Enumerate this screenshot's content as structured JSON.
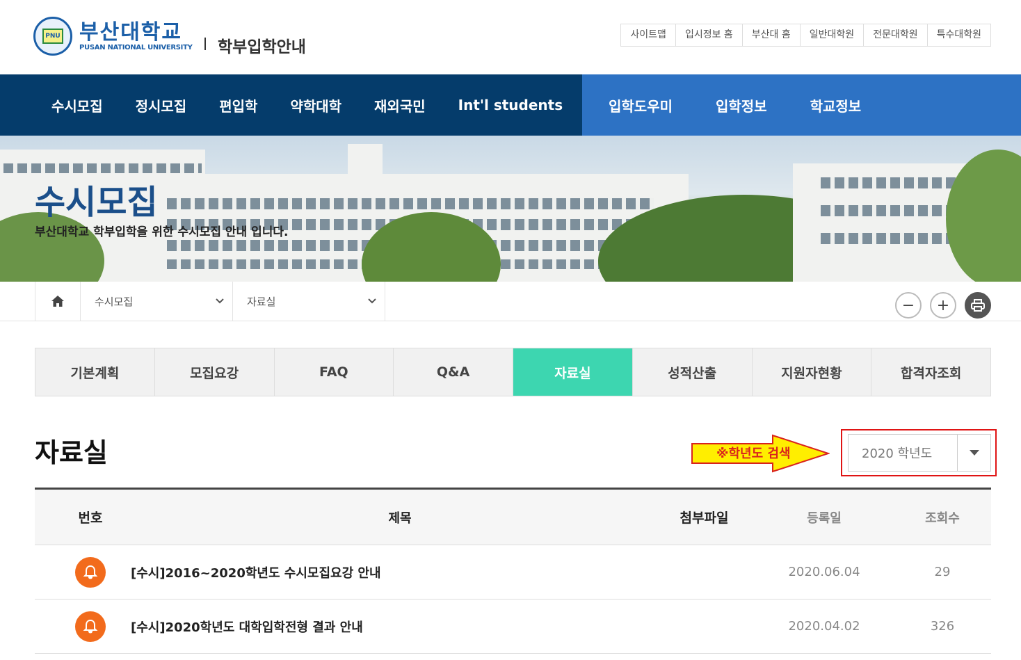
{
  "header": {
    "logo_kr": "부산대학교",
    "logo_en": "PUSAN NATIONAL UNIVERSITY",
    "logo_sub": "학부입학안내",
    "util_links": [
      "사이트맵",
      "입시정보 홈",
      "부산대 홈",
      "일반대학원",
      "전문대학원",
      "특수대학원"
    ]
  },
  "gnb": {
    "left": [
      "수시모집",
      "정시모집",
      "편입학",
      "약학대학",
      "재외국민",
      "Int'l students"
    ],
    "right": [
      "입학도우미",
      "입학정보",
      "학교정보"
    ]
  },
  "visual": {
    "title": "수시모집",
    "desc": "부산대학교 학부입학을 위한 수시모집 안내 입니다."
  },
  "location": {
    "home_icon": "home-icon",
    "sel1": "수시모집",
    "sel2": "자료실",
    "zoom_out": "−",
    "zoom_in": "+",
    "print_icon": "print-icon"
  },
  "tabs": [
    "기본계획",
    "모집요강",
    "FAQ",
    "Q&A",
    "자료실",
    "성적산출",
    "지원자현황",
    "합격자조회"
  ],
  "active_tab": 4,
  "page": {
    "title": "자료실",
    "annotation": "※학년도 검색",
    "year_select": "2020 학년도"
  },
  "table": {
    "headers": [
      "번호",
      "제목",
      "첨부파일",
      "등록일",
      "조회수"
    ],
    "rows": [
      {
        "title": "[수시]2016~2020학년도 수시모집요강 안내",
        "date": "2020.06.04",
        "views": "29"
      },
      {
        "title": "[수시]2020학년도 대학입학전형 결과 안내",
        "date": "2020.04.02",
        "views": "326"
      }
    ]
  },
  "colors": {
    "navy": "#053c6b",
    "blue": "#2d72c4",
    "mint": "#3dd6b0",
    "notice_orange": "#f26b1c"
  }
}
